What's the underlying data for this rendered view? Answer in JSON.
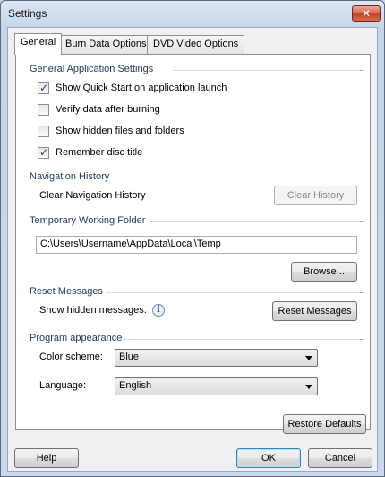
{
  "window": {
    "title": "Settings",
    "close_glyph": "✕"
  },
  "tabs": [
    {
      "label": "General",
      "active": true
    },
    {
      "label": "Burn Data Options",
      "active": false
    },
    {
      "label": "DVD Video Options",
      "active": false
    }
  ],
  "general_app": {
    "title": "General Application Settings",
    "options": [
      {
        "label": "Show Quick Start on application launch",
        "checked": true
      },
      {
        "label": "Verify data after burning",
        "checked": false
      },
      {
        "label": "Show hidden files and folders",
        "checked": false
      },
      {
        "label": "Remember disc title",
        "checked": true
      }
    ]
  },
  "navigation": {
    "title": "Navigation History",
    "label": "Clear Navigation History",
    "button": "Clear History"
  },
  "temp_folder": {
    "title": "Temporary Working Folder",
    "path": "C:\\Users\\Username\\AppData\\Local\\Temp",
    "browse_button": "Browse..."
  },
  "reset": {
    "title": "Reset Messages",
    "label": "Show hidden messages.",
    "button": "Reset Messages",
    "info_glyph": "i"
  },
  "appearance": {
    "title": "Program appearance",
    "color_label": "Color scheme:",
    "color_value": "Blue",
    "language_label": "Language:",
    "language_value": "English"
  },
  "restore_button": "Restore Defaults",
  "footer": {
    "help": "Help",
    "ok": "OK",
    "cancel": "Cancel"
  }
}
